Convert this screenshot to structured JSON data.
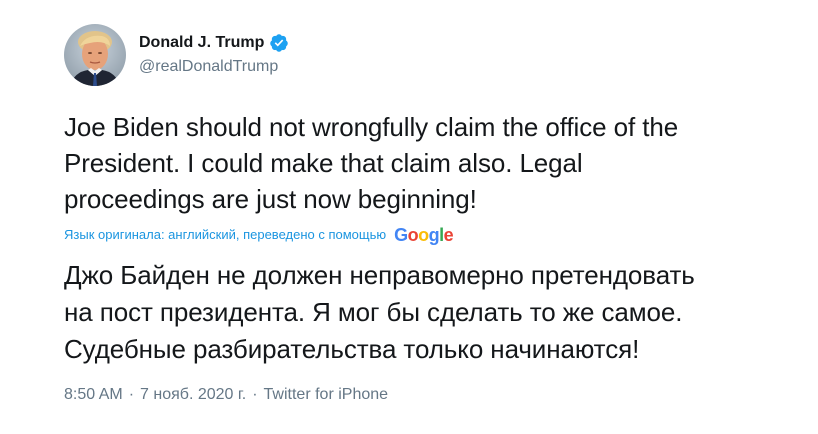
{
  "author": {
    "display_name": "Donald J. Trump",
    "handle": "@realDonaldTrump",
    "verified": true,
    "avatar_icon": "profile-photo-icon"
  },
  "tweet": {
    "text_lines_en": [
      "Joe Biden should not wrongfully claim the office of the",
      "President. I could make that claim also. Legal",
      "proceedings are just now beginning!"
    ],
    "translation_label": "Язык оригинала: английский, переведено с помощью",
    "translation_provider": "Google",
    "text_lines_ru": [
      "Джо Байден не должен неправомерно претендовать",
      "на пост президента. Я мог бы сделать то же самое.",
      "Судебные разбирательства только начинаются!"
    ]
  },
  "meta": {
    "time": "8:50 AM",
    "separator": "·",
    "date": "7 нояб. 2020 г.",
    "source": "Twitter for iPhone"
  },
  "colors": {
    "text": "#14171a",
    "secondary": "#657786",
    "link": "#1b95e0",
    "verified_badge": "#1da1f2"
  }
}
